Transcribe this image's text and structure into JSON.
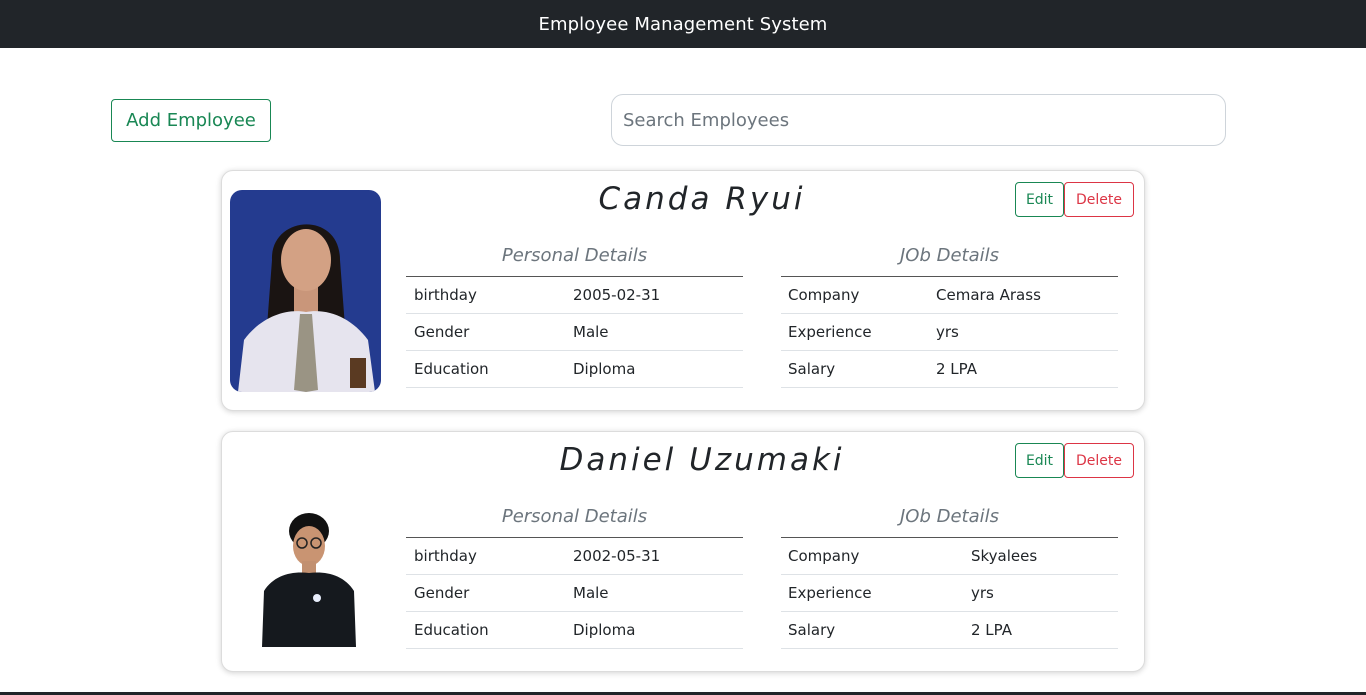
{
  "navbar": {
    "title": "Employee Management System"
  },
  "toolbar": {
    "add_label": "Add Employee",
    "search_placeholder": "Search Employees"
  },
  "employees": [
    {
      "name": "Canda Ryui",
      "edit_label": "Edit",
      "delete_label": "Delete",
      "personal": {
        "title": "Personal Details",
        "rows": [
          {
            "label": "birthday",
            "value": "2005-02-31"
          },
          {
            "label": "Gender",
            "value": "Male"
          },
          {
            "label": "Education",
            "value": "Diploma"
          }
        ]
      },
      "job": {
        "title": "JOb Details",
        "rows": [
          {
            "label": "Company",
            "value": "Cemara Arass"
          },
          {
            "label": "Experience",
            "value": "yrs"
          },
          {
            "label": "Salary",
            "value": "2 LPA"
          }
        ]
      }
    },
    {
      "name": "Daniel Uzumaki",
      "edit_label": "Edit",
      "delete_label": "Delete",
      "personal": {
        "title": "Personal Details",
        "rows": [
          {
            "label": "birthday",
            "value": "2002-05-31"
          },
          {
            "label": "Gender",
            "value": "Male"
          },
          {
            "label": "Education",
            "value": "Diploma"
          }
        ]
      },
      "job": {
        "title": "JOb Details",
        "rows": [
          {
            "label": "Company",
            "value": "Skyalees"
          },
          {
            "label": "Experience",
            "value": "yrs"
          },
          {
            "label": "Salary",
            "value": "2 LPA"
          }
        ]
      }
    }
  ],
  "colors": {
    "navbar_bg": "#212529",
    "success": "#198754",
    "danger": "#dc3545",
    "muted": "#6c757d"
  }
}
